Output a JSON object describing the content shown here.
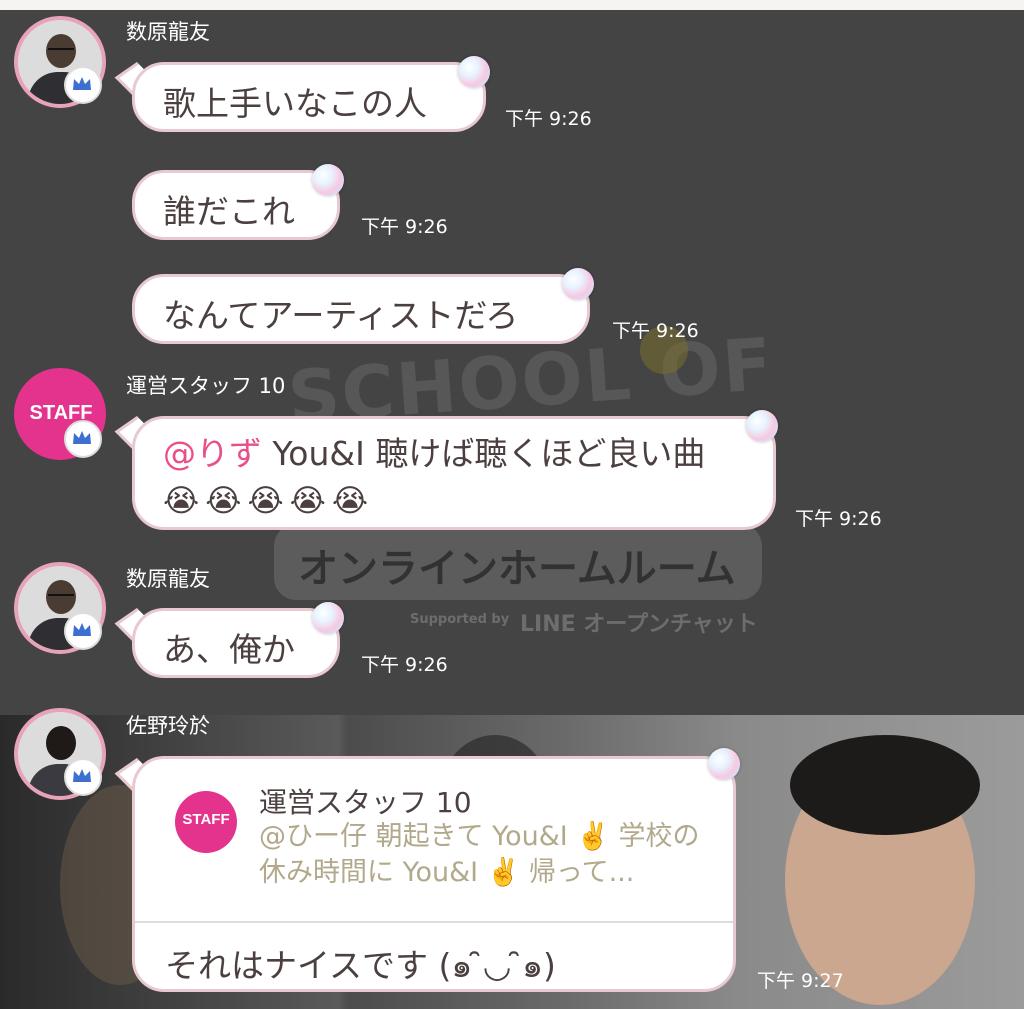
{
  "background": {
    "watermark_title": "SCHOOL OF LOCK!",
    "watermark_subtitle": "オンラインホームルーム",
    "watermark_supported": "Supported by",
    "watermark_brand": "LINE オープンチャット"
  },
  "messages": [
    {
      "sender": "数原龍友",
      "text": "歌上手いなこの人",
      "time": "下午 9:26"
    },
    {
      "text": "誰だこれ",
      "time": "下午 9:26"
    },
    {
      "text": "なんてアーティストだろ",
      "time": "下午 9:26"
    },
    {
      "sender": "運営スタッフ 10",
      "avatar_label": "STAFF",
      "mention": "@りず",
      "text": " You&I 聴けば聴くほど良い曲",
      "emoji": "😭😭😭😭😭",
      "time": "下午 9:26"
    },
    {
      "sender": "数原龍友",
      "text": "あ、俺か",
      "time": "下午 9:26"
    },
    {
      "sender": "佐野玲於",
      "reply": {
        "avatar_label": "STAFF",
        "name": "運営スタッフ 10",
        "text": "@ひー仔 朝起きて You&I ✌️ 学校の休み時間に You&I ✌️ 帰って..."
      },
      "text": "それはナイスです (๑ ̑◡ ̑๑)",
      "time": "下午 9:27"
    }
  ],
  "colors": {
    "dark_bg": "#444444",
    "avatar_ring": "#e9a3b9",
    "staff_pink": "#e4338d",
    "mention": "#e94f8a",
    "quote_text": "#b2a98c"
  }
}
